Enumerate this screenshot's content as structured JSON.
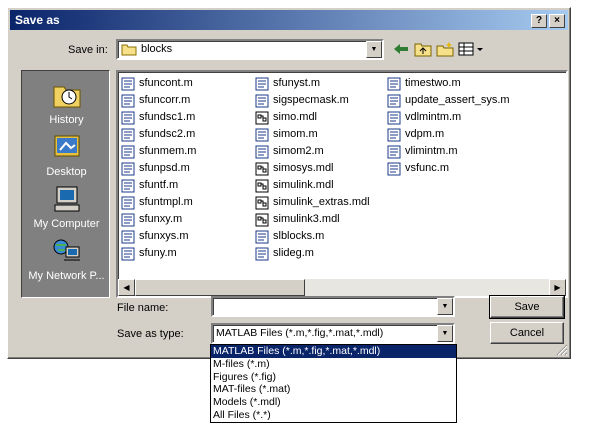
{
  "window": {
    "title": "Save as",
    "help_btn": "?",
    "close_btn": "×"
  },
  "save_in": {
    "label": "Save in:",
    "value": "blocks"
  },
  "places": [
    {
      "label": "History",
      "icon": "history-icon"
    },
    {
      "label": "Desktop",
      "icon": "desktop-icon"
    },
    {
      "label": "My Computer",
      "icon": "my-computer-icon"
    },
    {
      "label": "My Network P...",
      "icon": "network-places-icon"
    }
  ],
  "files": {
    "col1": [
      "sfuncont.m",
      "sfuncorr.m",
      "sfundsc1.m",
      "sfundsc2.m",
      "sfunmem.m",
      "sfunpsd.m",
      "sfuntf.m",
      "sfuntmpl.m",
      "sfunxy.m",
      "sfunxys.m",
      "sfuny.m"
    ],
    "col2": [
      "sfunyst.m",
      "sigspecmask.m",
      "simo.mdl",
      "simom.m",
      "simom2.m",
      "simosys.mdl",
      "simulink.mdl",
      "simulink_extras.mdl",
      "simulink3.mdl",
      "slblocks.m",
      "slideg.m"
    ],
    "col3": [
      "timestwo.m",
      "update_assert_sys.m",
      "vdlmintm.m",
      "vdpm.m",
      "vlimintm.m",
      "vsfunc.m"
    ]
  },
  "file_name": {
    "label": "File name:",
    "value": ""
  },
  "save_as_type": {
    "label": "Save as type:",
    "value": "MATLAB Files (*.m,*.fig,*.mat,*.mdl)",
    "options": [
      "MATLAB Files (*.m,*.fig,*.mat,*.mdl)",
      "M-files (*.m)",
      "Figures (*.fig)",
      "MAT-files (*.mat)",
      "Models (*.mdl)",
      "All Files (*.*)"
    ]
  },
  "buttons": {
    "save": "Save",
    "cancel": "Cancel"
  },
  "colors": {
    "title_start": "#0a246a",
    "title_end": "#a6caf0",
    "face": "#d4d0c8",
    "selection": "#0a246a"
  }
}
